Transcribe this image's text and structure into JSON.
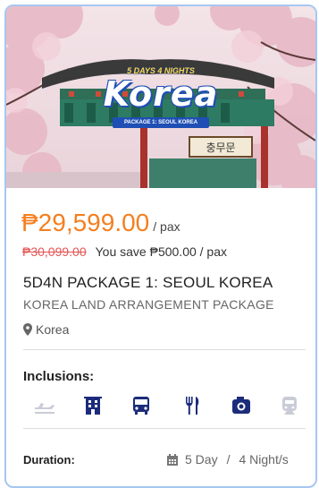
{
  "banner": {
    "top_line": "5 DAYS 4 NIGHTS",
    "title": "Korea",
    "subtitle": "PACKAGE 1: SEOUL KOREA",
    "sign_text": "충무문"
  },
  "pricing": {
    "price": "₱29,599.00",
    "per_pax": "/ pax",
    "old_price": "₱30,099.00",
    "savings": "You save ₱500.00 / pax"
  },
  "package": {
    "title": "5D4N PACKAGE 1: SEOUL KOREA",
    "subtitle": "KOREA LAND ARRANGEMENT PACKAGE",
    "location": "Korea"
  },
  "inclusions": {
    "heading": "Inclusions:",
    "icons": [
      "airplane-icon",
      "hotel-icon",
      "bus-icon",
      "meals-icon",
      "camera-icon",
      "train-icon"
    ]
  },
  "duration": {
    "label": "Duration:",
    "days": "5 Day",
    "separator": "/",
    "nights": "4 Night/s"
  },
  "colors": {
    "price": "#f47f1f",
    "old_price": "#e45656",
    "icon_active": "#1c2b7a",
    "icon_inactive": "#c9ccd6",
    "card_border": "#a7c7f0"
  }
}
